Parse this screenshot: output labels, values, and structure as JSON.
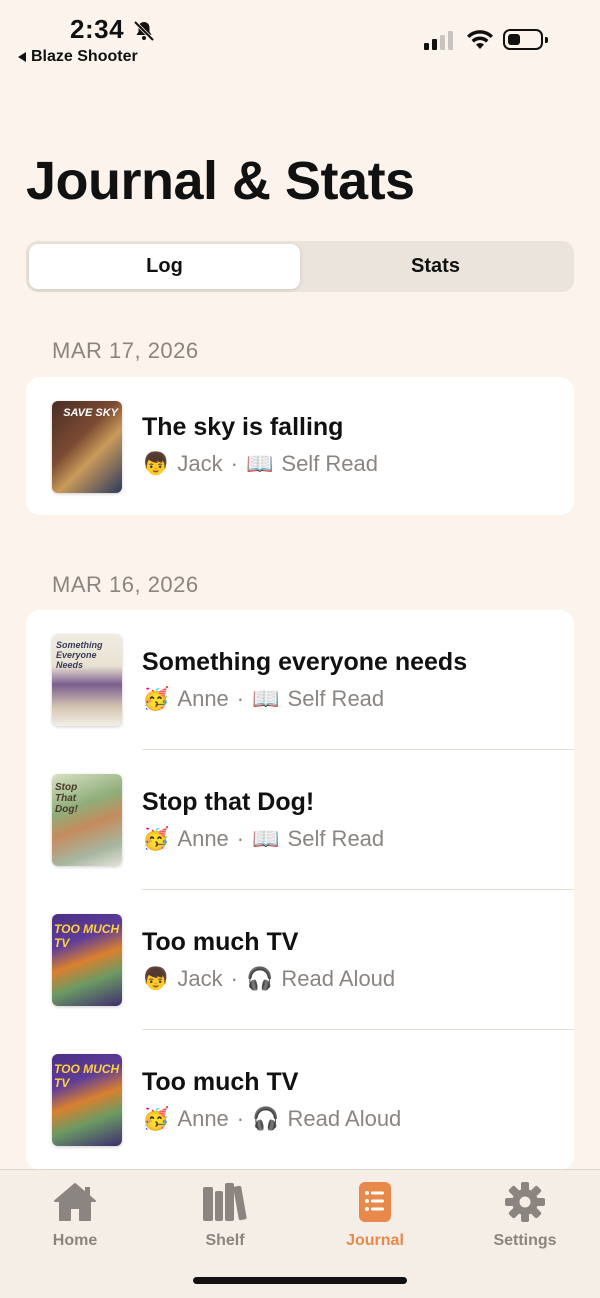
{
  "status_bar": {
    "time": "2:34",
    "back_app": "Blaze Shooter"
  },
  "page_title": "Journal & Stats",
  "segmented": {
    "tabs": [
      {
        "label": "Log",
        "active": true
      },
      {
        "label": "Stats",
        "active": false
      }
    ]
  },
  "groups": [
    {
      "date": "MAR 17, 2026",
      "entries": [
        {
          "title": "The sky is falling",
          "reader_emoji": "👦",
          "reader": "Jack",
          "mode_emoji": "📖",
          "mode": "Self Read",
          "cover_text": "SAVE SKY"
        }
      ]
    },
    {
      "date": "MAR 16, 2026",
      "entries": [
        {
          "title": "Something everyone needs",
          "reader_emoji": "🥳",
          "reader": "Anne",
          "mode_emoji": "📖",
          "mode": "Self Read",
          "cover_text": "Something Everyone Needs"
        },
        {
          "title": "Stop that Dog!",
          "reader_emoji": "🥳",
          "reader": "Anne",
          "mode_emoji": "📖",
          "mode": "Self Read",
          "cover_text": "Stop That Dog!"
        },
        {
          "title": "Too much TV",
          "reader_emoji": "👦",
          "reader": "Jack",
          "mode_emoji": "🎧",
          "mode": "Read Aloud",
          "cover_text": "TOO MUCH TV"
        },
        {
          "title": "Too much TV",
          "reader_emoji": "🥳",
          "reader": "Anne",
          "mode_emoji": "🎧",
          "mode": "Read Aloud",
          "cover_text": "TOO MUCH TV"
        }
      ]
    }
  ],
  "separator": "·",
  "tab_bar": {
    "tabs": [
      {
        "label": "Home",
        "icon": "home-icon",
        "active": false
      },
      {
        "label": "Shelf",
        "icon": "books-icon",
        "active": false
      },
      {
        "label": "Journal",
        "icon": "journal-icon",
        "active": true
      },
      {
        "label": "Settings",
        "icon": "gear-icon",
        "active": false
      }
    ]
  },
  "colors": {
    "background": "#fcf4ec",
    "accent": "#e8884a",
    "muted_text": "#8a8580"
  }
}
